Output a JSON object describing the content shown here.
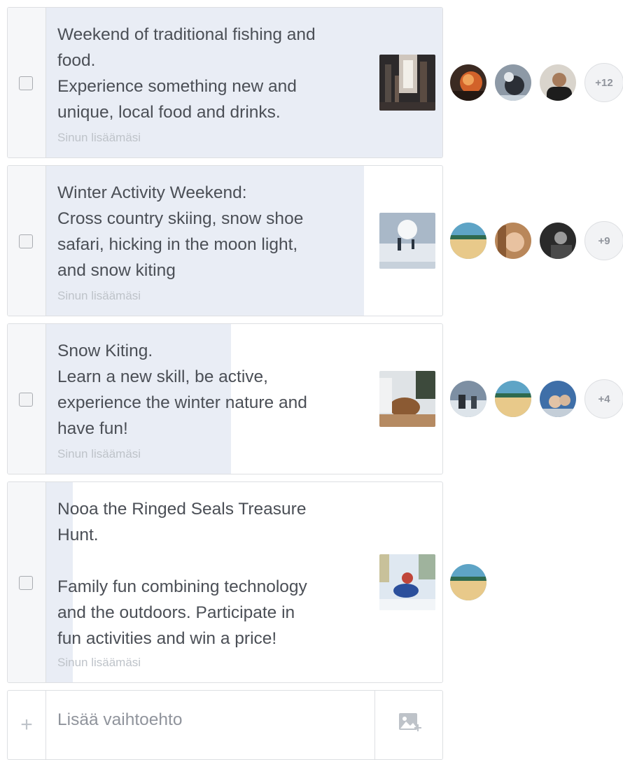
{
  "options": [
    {
      "lines": [
        "Weekend of traditional fishing and",
        "food.",
        "Experience something new and",
        "unique, local food and drinks."
      ],
      "added_by": "Sinun lisäämäsi",
      "more_count": "+12"
    },
    {
      "lines": [
        "Winter Activity Weekend:",
        "Cross country skiing, snow shoe",
        "safari, hicking in the moon light,",
        "and snow kiting"
      ],
      "added_by": "Sinun lisäämäsi",
      "more_count": "+9"
    },
    {
      "lines": [
        "Snow Kiting.",
        "Learn a new skill, be active,",
        "experience the winter nature and",
        "have fun!"
      ],
      "added_by": "Sinun lisäämäsi",
      "more_count": "+4"
    },
    {
      "lines": [
        "Nooa the Ringed Seals Treasure",
        "Hunt.",
        "",
        "Family fun combining technology",
        "and the outdoors. Participate in",
        "fun activities and win a price!"
      ],
      "added_by": "Sinun lisäämäsi"
    }
  ],
  "add_option": {
    "plus_icon": "plus-icon",
    "placeholder": "Lisää vaihtoehto",
    "image_icon": "add-photo-icon"
  },
  "colors": {
    "vote_bar": "#e9edf5",
    "border": "#dddfe2",
    "text": "#4b4f56",
    "muted": "#bec3c9"
  }
}
